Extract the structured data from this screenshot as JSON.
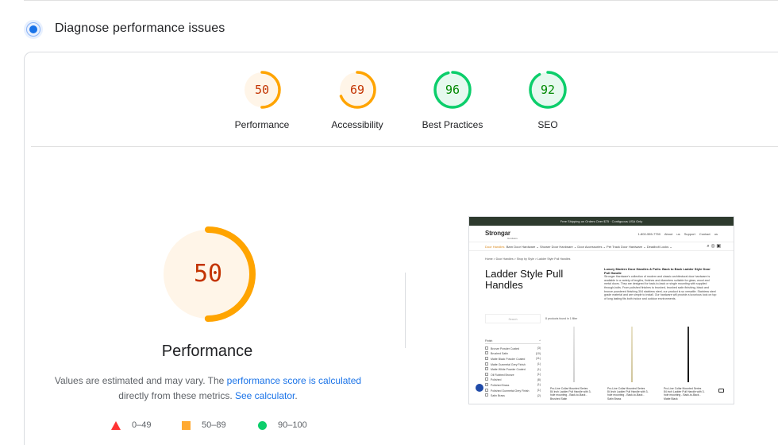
{
  "header": {
    "title": "Diagnose performance issues",
    "icon": "lighthouse-icon"
  },
  "gauges": [
    {
      "score": "50",
      "label": "Performance",
      "color": "#ffa400",
      "fill": 0.5
    },
    {
      "score": "69",
      "label": "Accessibility",
      "color": "#ffa400",
      "fill": 0.69
    },
    {
      "score": "96",
      "label": "Best Practices",
      "color": "#0cce6b",
      "fill": 0.96
    },
    {
      "score": "92",
      "label": "SEO",
      "color": "#0cce6b",
      "fill": 0.92
    }
  ],
  "main": {
    "score": "50",
    "fill": 0.5,
    "label": "Performance",
    "note_pre": "Values are estimated and may vary. The ",
    "note_link1": "performance score is calculated",
    "note_mid": "directly from these metrics. ",
    "note_link2": "See calculator",
    "note_end": "."
  },
  "legend": [
    {
      "shape": "triangle",
      "range": "0–49",
      "color": "#ff3333"
    },
    {
      "shape": "square",
      "range": "50–89",
      "color": "#ffaa33"
    },
    {
      "shape": "circle",
      "range": "90–100",
      "color": "#0cce6b"
    }
  ],
  "thumbnail": {
    "banner": "Free Shipping on Orders Over $75 · Contiguous USA Only",
    "logo": "Strongar",
    "logo_sub": "Hardware",
    "links": "1-800-555-7750 About us Support Contact us",
    "menu_active": "Door Handles",
    "menu": "Barn Door Hardware ⌄  Shower Door Hardware ⌄  Door Accessories ⌄  Pet Track Door Hardware ⌄  Deadbolt Locks ⌄",
    "breadcrumb": "Home  >  Door Handles  >  Shop by Style  >  Ladder Style Pull Handles",
    "title": "Ladder Style Pull Handles",
    "desc_title": "Luxury Modern Door Handles & Pulls: Back to Back Ladder Style Door Pull Handle",
    "desc": "Stronger Hardware's collection of modern and classic architectural door hardware is available in a variety of lengths, finishes and diameters suitable for glass, wood and metal doors. They are designed for back-to-back or single mounting with supplied through-bolts. From polished finishes to brushed, brushed satin finishing, black and bronze powdered finishing 304 stainless steel, our product is so versatile. Stainless steel grade material and are simple to install. Our hardware will provide a luxurious look on top of long lasting fits both indoor and outdoor environments.",
    "search": "Search",
    "count": "8 products found in 1 filter",
    "filter_heading": "Finish",
    "filters": [
      {
        "name": "Bronze Powder Coated",
        "count": "(3)"
      },
      {
        "name": "Brushed Satin",
        "count": "(10)"
      },
      {
        "name": "Matte Black Powder Coated",
        "count": "(11)"
      },
      {
        "name": "Matte Gunmetal Grey Finish",
        "count": "(1)"
      },
      {
        "name": "Matte White Powder Coated",
        "count": "(1)"
      },
      {
        "name": "Oil Rubbed Bronze",
        "count": "(1)"
      },
      {
        "name": "Polished",
        "count": "(8)"
      },
      {
        "name": "Polished Brass",
        "count": "(1)"
      },
      {
        "name": "Polished Gunmetal Grey Finish",
        "count": "(1)"
      },
      {
        "name": "Satin Brass",
        "count": "(2)"
      }
    ],
    "products": [
      "Pro-Line Collar Mounted Series 84 inch Ladder Pull Handle with 3-hole mounting - Back-to-Back - Brushed Satin",
      "Pro-Line Collar Mounted Series 84 inch Ladder Pull Handle with 3-hole mounting - Back-to-Back - Satin Brass",
      "Pro-Line Collar Mounted Series 84 inch Ladder Pull Handle with 3-hole mounting - Back-to-Back - Matte Black"
    ]
  }
}
